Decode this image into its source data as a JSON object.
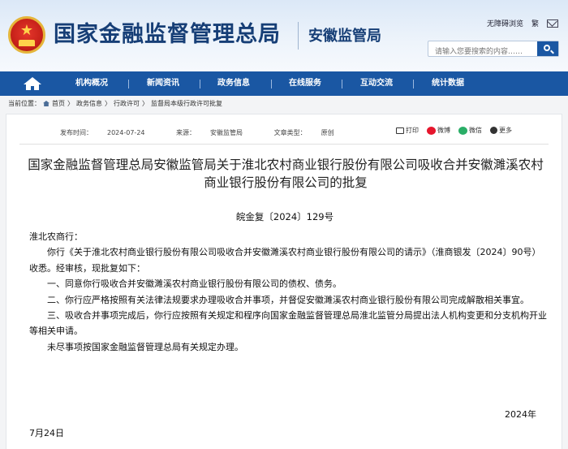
{
  "header": {
    "brand": "国家金融监督管理总局",
    "bureau": "安徽监管局",
    "links": {
      "accessibility": "无障碍浏览",
      "complex": "繁"
    },
    "search_placeholder": "请输入您要搜索的内容……"
  },
  "nav": {
    "items": [
      "机构概况",
      "新闻资讯",
      "政务信息",
      "在线服务",
      "互动交流",
      "统计数据"
    ]
  },
  "breadcrumb": {
    "label": "当前位置：",
    "items": [
      "首页",
      "政务信息",
      "行政许可",
      "监督局本级行政许可批复"
    ],
    "sep": "〉"
  },
  "article": {
    "meta": {
      "date_label": "发布时间：",
      "date": "2024-07-24",
      "source_label": "来源：",
      "source": "安徽监管局",
      "type_label": "文章类型：",
      "type": "原创"
    },
    "share": [
      "打印",
      "微博",
      "微信",
      "更多"
    ],
    "title_line1": "国家金融监督管理总局安徽监管局关于淮北农村商业银行股份有限公司吸收合并安徽濉溪农村",
    "title_line2": "商业银行股份有限公司的批复",
    "doc_no": "皖金复〔2024〕129号",
    "salutation": "淮北农商行：",
    "intro": "你行《关于淮北农村商业银行股份有限公司吸收合并安徽濉溪农村商业银行股份有限公司的请示》（淮商银发〔2024〕90号）收悉。经审核，现批复如下：",
    "items": [
      "一、同意你行吸收合并安徽濉溪农村商业银行股份有限公司的债权、债务。",
      "二、你行应严格按照有关法律法规要求办理吸收合并事项，并督促安徽濉溪农村商业银行股份有限公司完成解散相关事宜。",
      "三、吸收合并事项完成后，你行应按照有关规定和程序向国家金融监督管理总局淮北监管分局提出法人机构变更和分支机构开业等相关申请。",
      "未尽事项按国家金融监督管理总局有关规定办理。"
    ],
    "year": "2024年",
    "month_day": "7月24日"
  }
}
